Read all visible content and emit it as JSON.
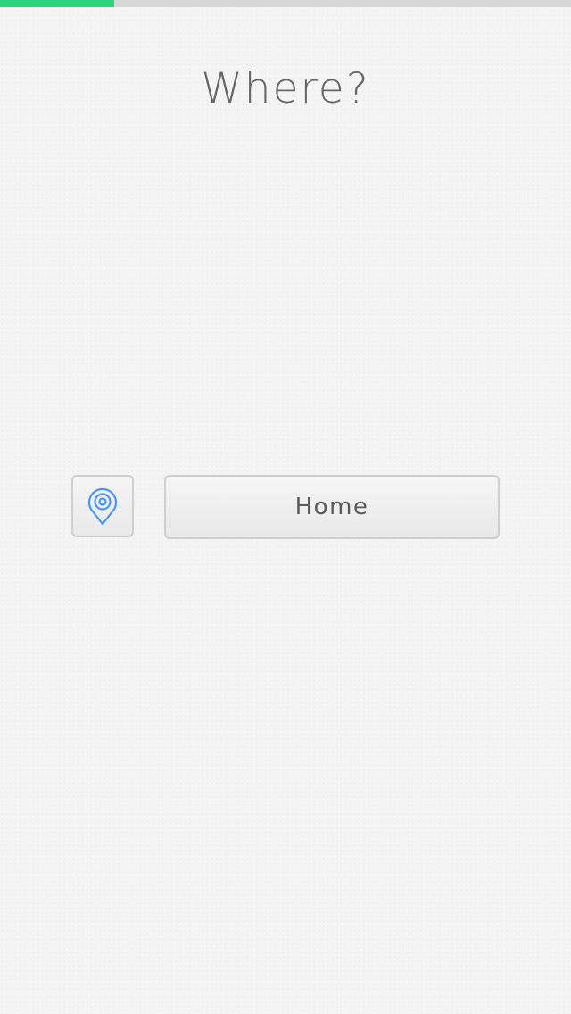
{
  "progress": {
    "fraction": 0.2,
    "color": "#2ed47a",
    "track_color": "#d6d7d6"
  },
  "header": {
    "title": "Where?"
  },
  "actions": {
    "location_icon": "location-pin-icon",
    "location_icon_color": "#4a97f2",
    "place_label": "Home"
  }
}
